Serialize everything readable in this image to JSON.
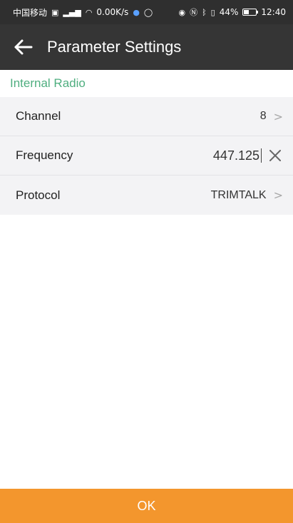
{
  "status_bar": {
    "carrier": "中国移动",
    "network_speed": "0.00K/s",
    "battery_percent": "44%",
    "time": "12:40",
    "icons": [
      "hd-icon",
      "signal-icon",
      "wifi-icon",
      "notification-icon",
      "eye-icon",
      "nfc-icon",
      "bluetooth-icon",
      "vibrate-icon",
      "battery-icon"
    ]
  },
  "app_bar": {
    "title": "Parameter Settings",
    "back_icon": "arrow-left-icon"
  },
  "section": {
    "title": "Internal Radio"
  },
  "settings": {
    "channel": {
      "label": "Channel",
      "value": "8"
    },
    "frequency": {
      "label": "Frequency",
      "value": "447.125"
    },
    "protocol": {
      "label": "Protocol",
      "value": "TRIMTALK"
    }
  },
  "footer": {
    "ok_label": "OK"
  },
  "colors": {
    "status_bar_bg": "#2f2f2f",
    "app_bar_bg": "#353535",
    "section_title": "#4fae7f",
    "row_bg": "#f3f3f5",
    "ok_button_bg": "#f3962d"
  }
}
